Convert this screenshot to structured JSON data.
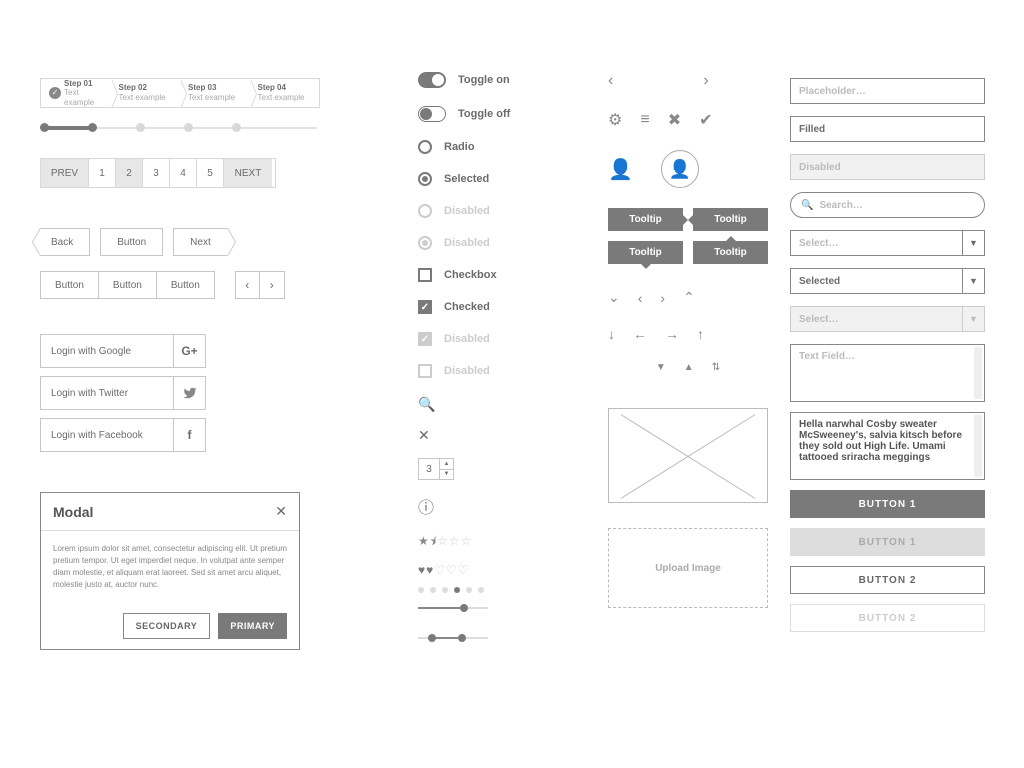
{
  "stepper": [
    {
      "title": "Step 01",
      "sub": "Text example",
      "done": true
    },
    {
      "title": "Step 02",
      "sub": "Text example",
      "done": false
    },
    {
      "title": "Step 03",
      "sub": "Text example",
      "done": false
    },
    {
      "title": "Step 04",
      "sub": "Text example",
      "done": false
    }
  ],
  "pagination": {
    "prev": "PREV",
    "next": "NEXT",
    "pages": [
      "1",
      "2",
      "3",
      "4",
      "5"
    ],
    "current": 1
  },
  "buttons": {
    "back": "Back",
    "button": "Button",
    "next": "Next"
  },
  "button_group": [
    "Button",
    "Button",
    "Button"
  ],
  "social": [
    {
      "label": "Login with Google",
      "icon": "G+"
    },
    {
      "label": "Login with Twitter",
      "icon": "t"
    },
    {
      "label": "Login with Facebook",
      "icon": "f"
    }
  ],
  "modal": {
    "title": "Modal",
    "body": "Lorem ipsum dolor sit amet, consectetur adipiscing elit. Ut pretium pretium tempor. Ut eget imperdiet neque. In volutpat ante semper diam molestie, et aliquam erat laoreet. Sed sit amet arcu aliquet, molestie justo at, auctor nunc.",
    "secondary": "SECONDARY",
    "primary": "PRIMARY"
  },
  "toggles": {
    "on": "Toggle on",
    "off": "Toggle off"
  },
  "radios": {
    "radio": "Radio",
    "selected": "Selected",
    "disabled": "Disabled",
    "disabled_sel": "Disabled"
  },
  "checkboxes": {
    "unchecked": "Checkbox",
    "checked": "Checked",
    "disabled_chk": "Disabled",
    "disabled": "Disabled"
  },
  "stepper_num": "3",
  "rating": {
    "stars": 1.5,
    "hearts": 2.5,
    "dots_active": 3,
    "dots_total": 6
  },
  "tooltip": "Tooltip",
  "upload": "Upload Image",
  "inputs": {
    "placeholder": "Placeholder…",
    "filled": "Filled",
    "disabled": "Disabled",
    "search": "Search…",
    "select_ph": "Select…",
    "selected": "Selected",
    "textfield": "Text Field…",
    "textarea_filled": "Hella narwhal Cosby sweater McSweeney's, salvia kitsch before they sold out High Life. Umami tattooed sriracha meggings"
  },
  "big_buttons": {
    "b1": "BUTTON 1",
    "b2": "BUTTON 2"
  }
}
